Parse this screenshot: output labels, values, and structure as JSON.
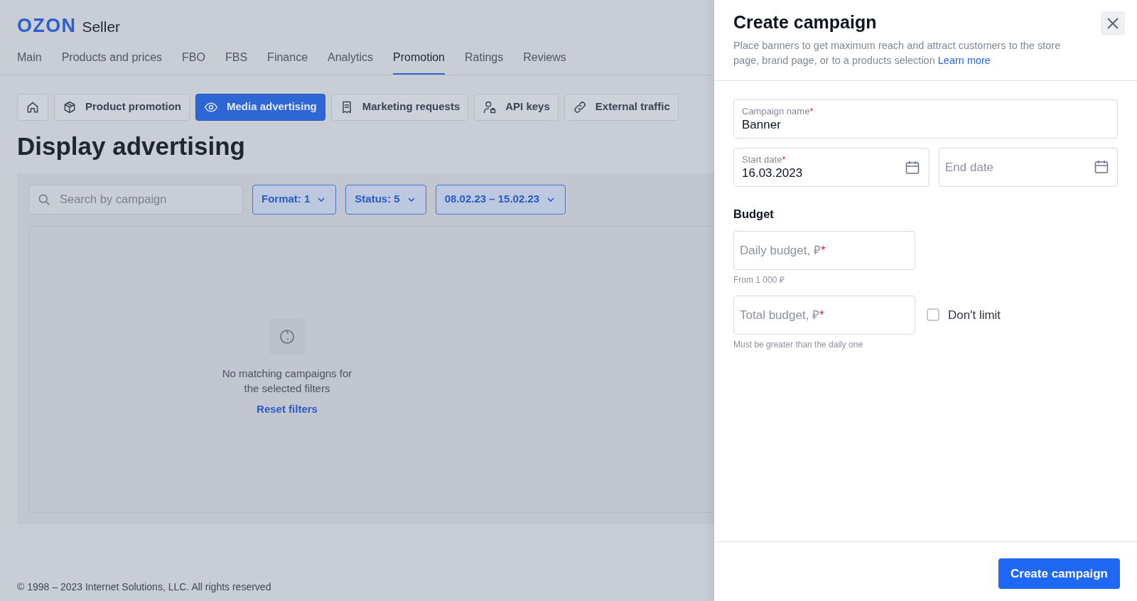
{
  "brand": {
    "logo": "OZON",
    "product": "Seller"
  },
  "nav": [
    {
      "label": "Main",
      "selected": false
    },
    {
      "label": "Products and prices",
      "selected": false
    },
    {
      "label": "FBO",
      "selected": false
    },
    {
      "label": "FBS",
      "selected": false
    },
    {
      "label": "Finance",
      "selected": false
    },
    {
      "label": "Analytics",
      "selected": false
    },
    {
      "label": "Promotion",
      "selected": true
    },
    {
      "label": "Ratings",
      "selected": false
    },
    {
      "label": "Reviews",
      "selected": false
    }
  ],
  "subtabs": [
    {
      "kind": "home",
      "selected": false
    },
    {
      "kind": "box",
      "label": "Product promotion",
      "selected": false
    },
    {
      "kind": "eye",
      "label": "Media advertising",
      "selected": true
    },
    {
      "kind": "document",
      "label": "Marketing requests",
      "selected": false
    },
    {
      "kind": "user",
      "label": "API keys",
      "selected": false
    },
    {
      "kind": "link",
      "label": "External traffic",
      "selected": false
    }
  ],
  "page_title": "Display advertising",
  "search": {
    "placeholder": "Search by campaign"
  },
  "filters": [
    {
      "label": "Format: 1"
    },
    {
      "label": "Status: 5"
    },
    {
      "label": "08.02.23 – 15.02.23"
    }
  ],
  "empty_state": {
    "message": "No matching campaigns for the selected filters",
    "action": "Reset filters"
  },
  "footer": "© 1998 – 2023 Internet Solutions, LLC. All rights reserved",
  "drawer": {
    "title": "Create campaign",
    "description": "Place banners to get maximum reach and attract customers to the store page, brand page, or to a products selection",
    "learn_more": "Learn more",
    "campaign_name": {
      "label": "Campaign name",
      "required_mark": "*",
      "value": "Banner"
    },
    "start_date": {
      "label": "Start date",
      "required_mark": "*",
      "value": "16.03.2023"
    },
    "end_date": {
      "placeholder": "End date"
    },
    "budget_title": "Budget",
    "daily_budget": {
      "placeholder": "Daily budget, ₽",
      "required_mark": "*",
      "hint": "From 1 000 ₽"
    },
    "total_budget": {
      "placeholder": "Total budget, ₽",
      "required_mark": "*",
      "hint": "Must be greater than the daily one"
    },
    "dont_limit": {
      "label": "Don't limit",
      "checked": false
    },
    "submit": "Create campaign"
  }
}
